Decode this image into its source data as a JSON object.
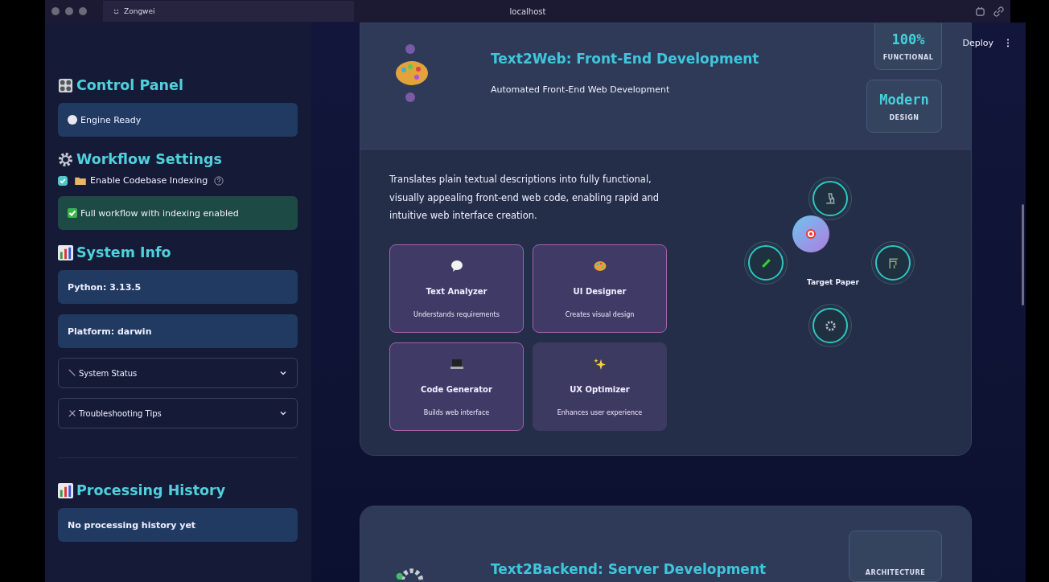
{
  "browser": {
    "tab_title": "Zongwei",
    "address": "localhost"
  },
  "header": {
    "deploy": "Deploy"
  },
  "sidebar": {
    "control_panel": {
      "title": "Control Panel",
      "status": "Engine Ready"
    },
    "workflow_settings": {
      "title": "Workflow Settings",
      "checkbox": {
        "label": "Enable Codebase Indexing",
        "checked": true
      },
      "message": "Full workflow with indexing enabled"
    },
    "system_info": {
      "title": "System Info",
      "python": "Python: 3.13.5",
      "platform": "Platform: darwin",
      "expanders": [
        {
          "label": "System Status",
          "expanded": false
        },
        {
          "label": "Troubleshooting Tips",
          "expanded": false
        }
      ]
    },
    "processing_history": {
      "title": "Processing History",
      "message": "No processing history yet"
    }
  },
  "cards": [
    {
      "title": "Text2Web: Front-End Development",
      "subtitle": "Automated Front-End Web Development",
      "stats": [
        {
          "value": "100%",
          "label": "FUNCTIONAL"
        },
        {
          "value": "Modern",
          "label": "DESIGN"
        }
      ],
      "description": "Translates plain textual descriptions into fully functional, visually appealing front-end web code, enabling rapid and intuitive web interface creation.",
      "agents": [
        {
          "name": "Text Analyzer",
          "desc": "Understands requirements",
          "highlighted": true
        },
        {
          "name": "UI Designer",
          "desc": "Creates visual design",
          "highlighted": true
        },
        {
          "name": "Code Generator",
          "desc": "Builds web interface",
          "highlighted": true
        },
        {
          "name": "UX Optimizer",
          "desc": "Enhances user experience",
          "highlighted": false
        }
      ],
      "diagram": {
        "label": "Target Paper"
      }
    },
    {
      "title": "Text2Backend: Server Development",
      "stats": [
        {
          "label": "ARCHITECTURE"
        }
      ]
    }
  ]
}
